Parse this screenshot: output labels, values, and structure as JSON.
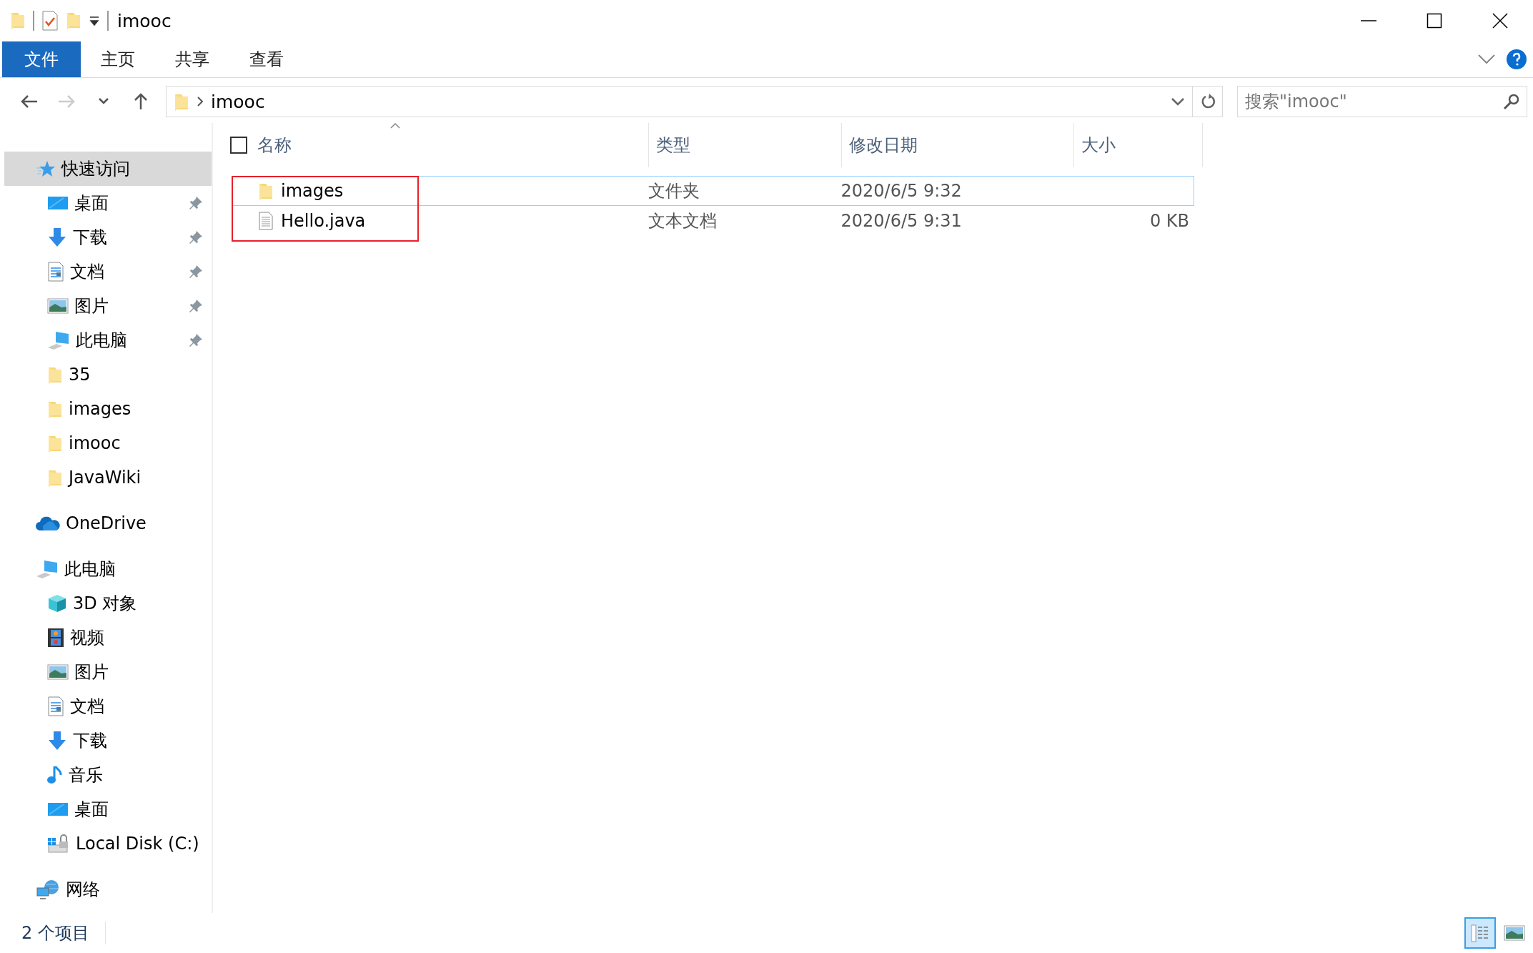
{
  "window": {
    "title": "imooc"
  },
  "ribbon": {
    "tabs": [
      {
        "label": "文件",
        "kind": "file",
        "selected": false
      },
      {
        "label": "主页",
        "kind": "tab",
        "selected": false
      },
      {
        "label": "共享",
        "kind": "tab",
        "selected": false
      },
      {
        "label": "查看",
        "kind": "tab",
        "selected": false
      }
    ]
  },
  "address": {
    "path": [
      "imooc"
    ]
  },
  "search": {
    "placeholder": "搜索\"imooc\""
  },
  "sidebar": {
    "sections": [
      {
        "label": "快速访问",
        "kind": "star",
        "selected": true,
        "children": [
          {
            "label": "桌面",
            "kind": "desktop",
            "pinned": true
          },
          {
            "label": "下载",
            "kind": "download",
            "pinned": true
          },
          {
            "label": "文档",
            "kind": "document",
            "pinned": true
          },
          {
            "label": "图片",
            "kind": "picture",
            "pinned": true
          },
          {
            "label": "此电脑",
            "kind": "computer",
            "pinned": true
          },
          {
            "label": "35",
            "kind": "folder",
            "pinned": false
          },
          {
            "label": "images",
            "kind": "folder",
            "pinned": false
          },
          {
            "label": "imooc",
            "kind": "folder",
            "pinned": false
          },
          {
            "label": "JavaWiki",
            "kind": "folder",
            "pinned": false
          }
        ]
      },
      {
        "label": "OneDrive",
        "kind": "cloud",
        "selected": false
      },
      {
        "label": "此电脑",
        "kind": "computer",
        "selected": false,
        "children": [
          {
            "label": "3D 对象",
            "kind": "cube",
            "pinned": false
          },
          {
            "label": "视频",
            "kind": "video",
            "pinned": false
          },
          {
            "label": "图片",
            "kind": "picture",
            "pinned": false
          },
          {
            "label": "文档",
            "kind": "document",
            "pinned": false
          },
          {
            "label": "下载",
            "kind": "download",
            "pinned": false
          },
          {
            "label": "音乐",
            "kind": "music",
            "pinned": false
          },
          {
            "label": "桌面",
            "kind": "desktop",
            "pinned": false
          },
          {
            "label": "Local Disk (C:)",
            "kind": "disk",
            "pinned": false
          }
        ]
      },
      {
        "label": "网络",
        "kind": "network",
        "selected": false
      }
    ]
  },
  "table": {
    "select_all": {
      "checked": false
    },
    "columns": [
      "名称",
      "类型",
      "修改日期",
      "大小"
    ],
    "rows": [
      {
        "name": "images",
        "kind": "folder",
        "type": "文件夹",
        "modified": "2020/6/5 9:32",
        "focused": true,
        "marked": true
      },
      {
        "name": "Hello.java",
        "kind": "textfile",
        "type": "文本文档",
        "modified": "2020/6/5 9:31",
        "size": "0 KB",
        "focused": false,
        "marked": true
      }
    ]
  },
  "status_bar": {
    "count": "2 个项目",
    "view_buttons": [
      {
        "kind": "details",
        "selected": true
      },
      {
        "kind": "thumbnails",
        "selected": false
      }
    ]
  }
}
